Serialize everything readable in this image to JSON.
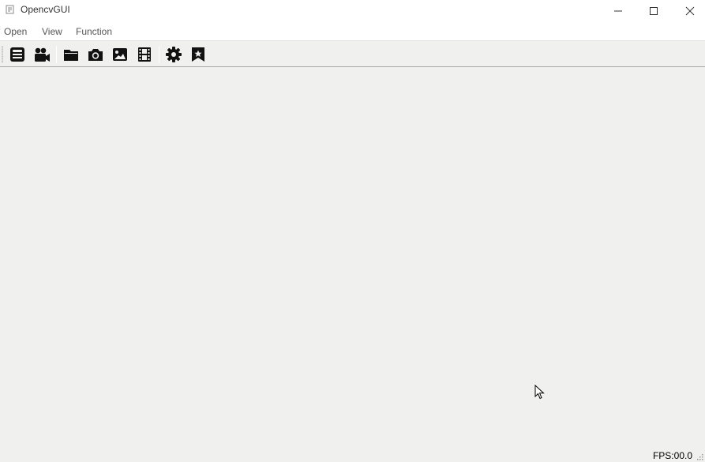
{
  "window": {
    "title": "OpencvGUI",
    "controls": [
      "minimize-icon",
      "maximize-icon",
      "close-icon"
    ]
  },
  "menubar": {
    "items": [
      {
        "label": "Open"
      },
      {
        "label": "View"
      },
      {
        "label": "Function"
      }
    ]
  },
  "toolbar": {
    "groups": [
      [
        "save-icon",
        "video-camera-icon"
      ],
      [
        "folder-open-icon",
        "camera-icon",
        "image-icon",
        "film-icon"
      ],
      [
        "gear-icon",
        "bookmark-star-icon"
      ]
    ]
  },
  "statusbar": {
    "fps_text": "FPS:00.0"
  }
}
